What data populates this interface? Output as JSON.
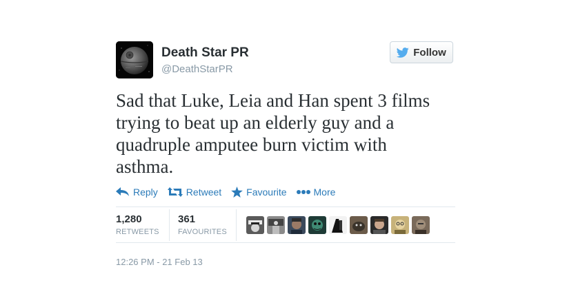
{
  "header": {
    "display_name": "Death Star PR",
    "handle": "@DeathStarPR",
    "follow_label": "Follow"
  },
  "tweet": {
    "lines": [
      "Sad that Luke, Leia and Han spent 3 films",
      "trying to beat up an elderly guy and a",
      "quadruple amputee burn victim with",
      "asthma."
    ]
  },
  "actions": {
    "reply": "Reply",
    "retweet": "Retweet",
    "favourite": "Favourite",
    "more": "More"
  },
  "stats": {
    "retweets_count": "1,280",
    "retweets_label": "RETWEETS",
    "favourites_count": "361",
    "favourites_label": "FAVOURITES"
  },
  "timestamp": "12:26 PM - 21 Feb 13",
  "colors": {
    "link_blue": "#2b7bb9",
    "twitter_blue": "#55acee",
    "text": "#292f33",
    "muted": "#8899a6"
  }
}
